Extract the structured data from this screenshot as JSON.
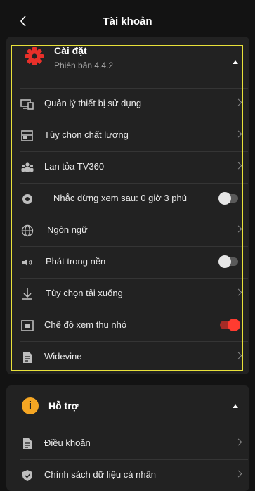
{
  "header": {
    "title": "Tài khoản"
  },
  "settings": {
    "title": "Cài đặt",
    "version": "Phiên bản 4.4.2",
    "items": [
      {
        "label": "Quản lý thiết bị sử dụng",
        "icon": "devices-icon",
        "control": "chevron"
      },
      {
        "label": "Tùy chọn chất lượng",
        "icon": "quality-icon",
        "control": "chevron"
      },
      {
        "label": "Lan tỏa TV360",
        "icon": "share-people-icon",
        "control": "chevron"
      },
      {
        "label": "Nhắc dừng xem sau: 0 giờ 3 phú",
        "icon": "timer-icon",
        "control": "toggle",
        "state": "off"
      },
      {
        "label": "Ngôn ngữ",
        "icon": "globe-icon",
        "control": "chevron"
      },
      {
        "label": "Phát trong nền",
        "icon": "speaker-icon",
        "control": "toggle",
        "state": "off"
      },
      {
        "label": "Tùy chọn tải xuống",
        "icon": "download-icon",
        "control": "chevron"
      },
      {
        "label": "Chế độ xem thu nhỏ",
        "icon": "pip-icon",
        "control": "toggle",
        "state": "on"
      },
      {
        "label": "Widevine",
        "icon": "document-icon",
        "control": "chevron"
      }
    ]
  },
  "support": {
    "title": "Hỗ trợ",
    "items": [
      {
        "label": "Điều khoản",
        "icon": "document-icon",
        "control": "chevron"
      },
      {
        "label": "Chính sách dữ liệu cá nhân",
        "icon": "shield-icon",
        "control": "chevron"
      }
    ]
  },
  "colors": {
    "background": "#131313",
    "card": "#222222",
    "accent": "#e8302a",
    "highlight": "#e8e13a",
    "support_icon": "#f5a623"
  }
}
